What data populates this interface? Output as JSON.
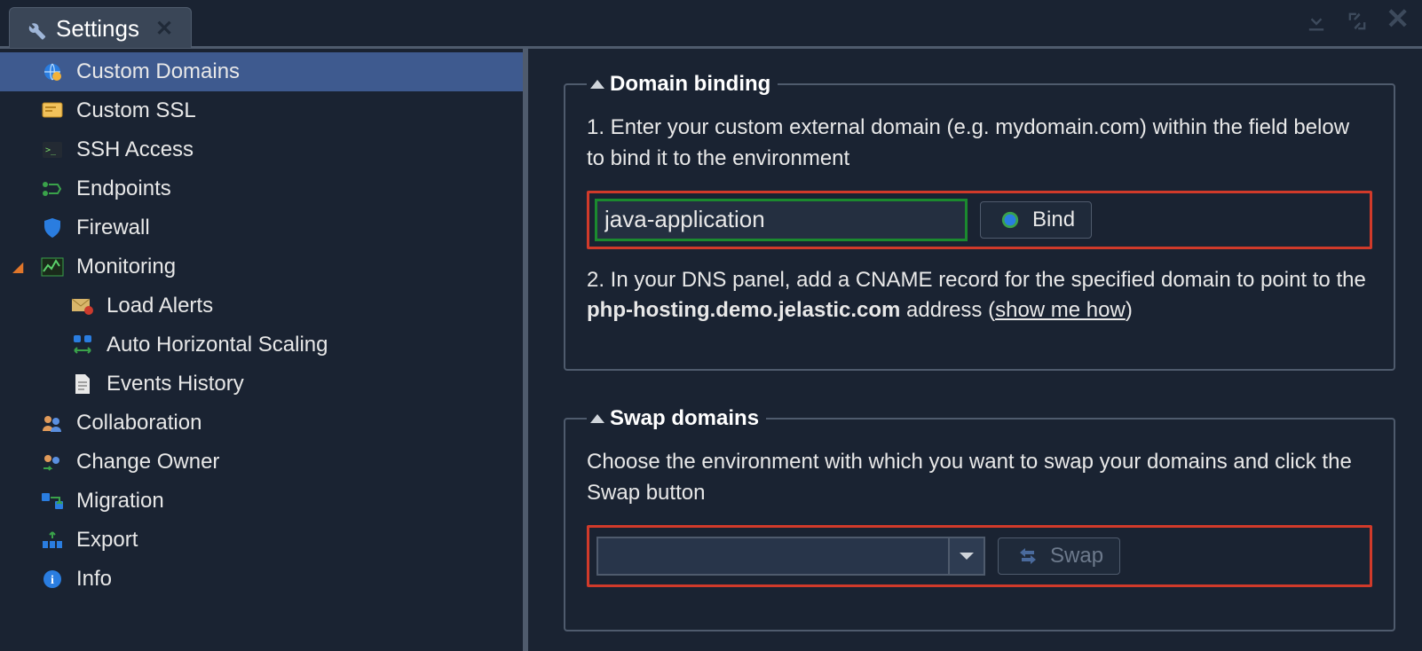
{
  "tab": {
    "title": "Settings"
  },
  "sidebar": {
    "items": [
      {
        "label": "Custom Domains",
        "selected": true
      },
      {
        "label": "Custom SSL"
      },
      {
        "label": "SSH Access"
      },
      {
        "label": "Endpoints"
      },
      {
        "label": "Firewall"
      },
      {
        "label": "Monitoring",
        "expanded": true,
        "children": [
          {
            "label": "Load Alerts"
          },
          {
            "label": "Auto Horizontal Scaling"
          },
          {
            "label": "Events History"
          }
        ]
      },
      {
        "label": "Collaboration"
      },
      {
        "label": "Change Owner"
      },
      {
        "label": "Migration"
      },
      {
        "label": "Export"
      },
      {
        "label": "Info"
      }
    ]
  },
  "main": {
    "domain_binding": {
      "title": "Domain binding",
      "step1": "1. Enter your custom external domain (e.g. mydomain.com) within the field below to bind it to the environment",
      "input_value": "java-application",
      "bind_button": "Bind",
      "step2_prefix": "2. In your DNS panel, add a CNAME record for the specified domain to point to the ",
      "step2_bold": "php-hosting.demo.jelastic.com",
      "step2_suffix": " address (",
      "step2_link": "show me how",
      "step2_close": ")"
    },
    "swap_domains": {
      "title": "Swap domains",
      "instruction": "Choose the environment with which you want to swap your domains and click the Swap button",
      "combo_value": "",
      "swap_button": "Swap"
    }
  }
}
